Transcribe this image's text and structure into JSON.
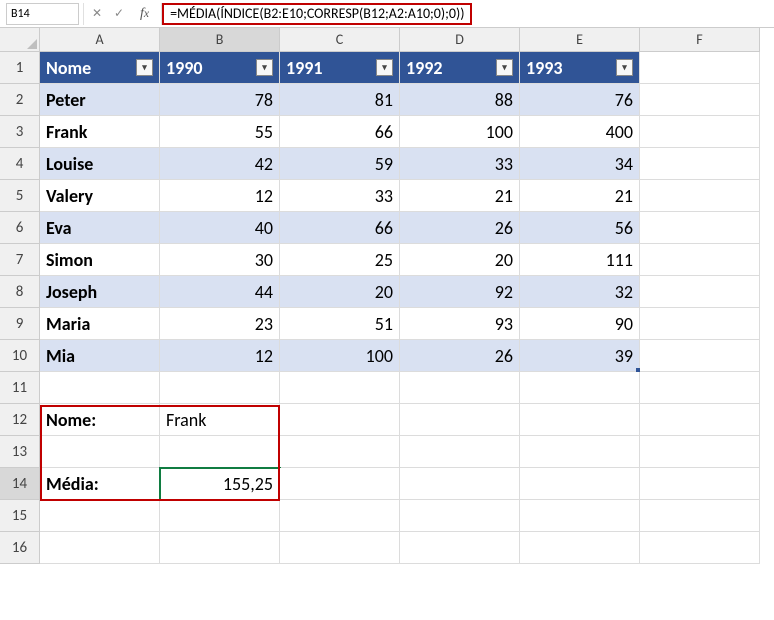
{
  "active_cell_ref": "B14",
  "formula": "=MÉDIA(ÍNDICE(B2:E10;CORRESP(B12;A2:A10;0);0))",
  "columns": [
    "A",
    "B",
    "C",
    "D",
    "E",
    "F"
  ],
  "table": {
    "headers": [
      "Nome",
      "1990",
      "1991",
      "1992",
      "1993"
    ],
    "rows": [
      {
        "name": "Peter",
        "v": [
          78,
          81,
          88,
          76
        ]
      },
      {
        "name": "Frank",
        "v": [
          55,
          66,
          100,
          400
        ]
      },
      {
        "name": "Louise",
        "v": [
          42,
          59,
          33,
          34
        ]
      },
      {
        "name": "Valery",
        "v": [
          12,
          33,
          21,
          21
        ]
      },
      {
        "name": "Eva",
        "v": [
          40,
          66,
          26,
          56
        ]
      },
      {
        "name": "Simon",
        "v": [
          30,
          25,
          20,
          111
        ]
      },
      {
        "name": "Joseph",
        "v": [
          44,
          20,
          92,
          32
        ]
      },
      {
        "name": "Maria",
        "v": [
          23,
          51,
          93,
          90
        ]
      },
      {
        "name": "Mia",
        "v": [
          12,
          100,
          26,
          39
        ]
      }
    ]
  },
  "lookup": {
    "name_label": "Nome:",
    "name_value": "Frank",
    "avg_label": "Média:",
    "avg_value": "155,25"
  },
  "row_count": 16
}
